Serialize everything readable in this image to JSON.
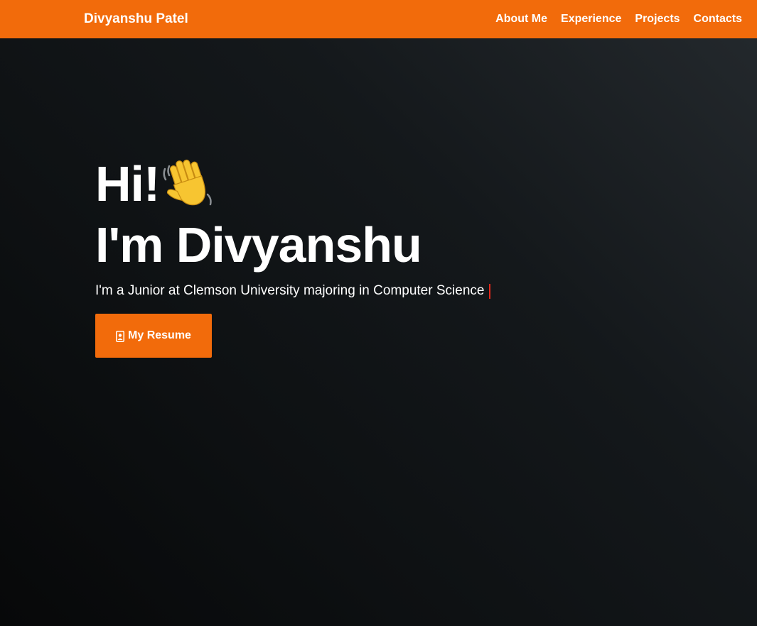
{
  "nav": {
    "brand": "Divyanshu Patel",
    "links": [
      {
        "label": "About Me"
      },
      {
        "label": "Experience"
      },
      {
        "label": "Projects"
      },
      {
        "label": "Contacts"
      }
    ]
  },
  "hero": {
    "greeting": "Hi!",
    "greeting_icon": "waving-hand-icon",
    "name_line": "I'm Divyanshu",
    "tagline": "I'm a Junior at Clemson University majoring in Computer Science",
    "resume_button": {
      "icon": "file-person-icon",
      "label": "My Resume"
    }
  },
  "colors": {
    "accent": "#f26b0b",
    "background": "#0e1113",
    "text": "#ffffff",
    "cursor": "#e3281b"
  }
}
